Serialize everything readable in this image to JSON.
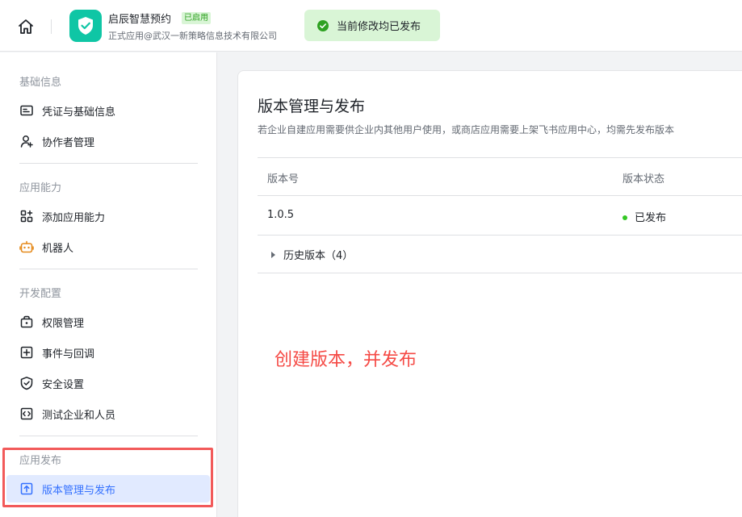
{
  "header": {
    "app_name": "启辰智慧预约",
    "app_badge": "已启用",
    "app_subtitle": "正式应用@武汉一新策略信息技术有限公司",
    "toast": "当前修改均已发布"
  },
  "sidebar": {
    "sections": [
      {
        "title": "基础信息",
        "items": [
          {
            "label": "凭证与基础信息",
            "icon": "credential-icon"
          },
          {
            "label": "协作者管理",
            "icon": "user-add-icon"
          }
        ]
      },
      {
        "title": "应用能力",
        "items": [
          {
            "label": "添加应用能力",
            "icon": "grid-add-icon"
          },
          {
            "label": "机器人",
            "icon": "robot-icon"
          }
        ]
      },
      {
        "title": "开发配置",
        "items": [
          {
            "label": "权限管理",
            "icon": "permission-icon"
          },
          {
            "label": "事件与回调",
            "icon": "event-icon"
          },
          {
            "label": "安全设置",
            "icon": "shield-icon"
          },
          {
            "label": "测试企业和人员",
            "icon": "code-icon"
          }
        ]
      },
      {
        "title": "应用发布",
        "items": [
          {
            "label": "版本管理与发布",
            "icon": "upload-icon",
            "active": true
          }
        ]
      }
    ]
  },
  "main": {
    "title": "版本管理与发布",
    "description": "若企业自建应用需要供企业内其他用户使用，或商店应用需要上架飞书应用中心，均需先发布版本",
    "table": {
      "headers": [
        "版本号",
        "版本状态"
      ],
      "rows": [
        {
          "version": "1.0.5",
          "status": "已发布"
        }
      ],
      "history": "历史版本（4）"
    },
    "annotation": "创建版本，并发布"
  },
  "colors": {
    "accent": "#3370ff",
    "success": "#34c724",
    "annotation": "#f54a45",
    "app_logo": "#0fc6a5"
  }
}
